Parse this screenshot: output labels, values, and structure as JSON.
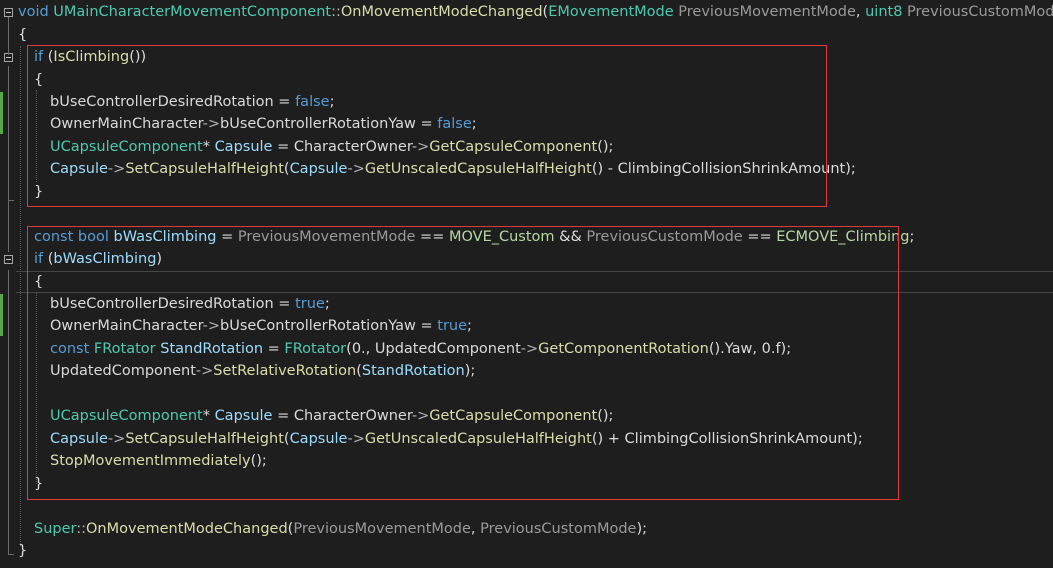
{
  "editor": {
    "lines": [
      {
        "indent": 0,
        "tokens": [
          {
            "t": "void",
            "c": "kw"
          },
          {
            "t": " ",
            "c": "t"
          },
          {
            "t": "UMainCharacterMovementComponent",
            "c": "ty"
          },
          {
            "t": "::",
            "c": "op"
          },
          {
            "t": "OnMovementModeChanged",
            "c": "fn"
          },
          {
            "t": "(",
            "c": "t"
          },
          {
            "t": "EMovementMode",
            "c": "ty"
          },
          {
            "t": " ",
            "c": "t"
          },
          {
            "t": "PreviousMovementMode",
            "c": "pm"
          },
          {
            "t": ", ",
            "c": "t"
          },
          {
            "t": "uint8",
            "c": "ty"
          },
          {
            "t": " ",
            "c": "t"
          },
          {
            "t": "PreviousCustomMode",
            "c": "pm"
          },
          {
            "t": ")",
            "c": "t"
          }
        ]
      },
      {
        "indent": 0,
        "tokens": [
          {
            "t": "{",
            "c": "t"
          }
        ]
      },
      {
        "indent": 1,
        "tokens": [
          {
            "t": "if",
            "c": "kw"
          },
          {
            "t": " (",
            "c": "t"
          },
          {
            "t": "IsClimbing",
            "c": "fn"
          },
          {
            "t": "())",
            "c": "t"
          }
        ]
      },
      {
        "indent": 1,
        "tokens": [
          {
            "t": "{",
            "c": "t"
          }
        ]
      },
      {
        "indent": 2,
        "tokens": [
          {
            "t": "bUseControllerDesiredRotation",
            "c": "mb"
          },
          {
            "t": " = ",
            "c": "t"
          },
          {
            "t": "false",
            "c": "kw"
          },
          {
            "t": ";",
            "c": "t"
          }
        ]
      },
      {
        "indent": 2,
        "tokens": [
          {
            "t": "OwnerMainCharacter",
            "c": "mb"
          },
          {
            "t": "->",
            "c": "op"
          },
          {
            "t": "bUseControllerRotationYaw",
            "c": "mb"
          },
          {
            "t": " = ",
            "c": "t"
          },
          {
            "t": "false",
            "c": "kw"
          },
          {
            "t": ";",
            "c": "t"
          }
        ]
      },
      {
        "indent": 2,
        "tokens": [
          {
            "t": "UCapsuleComponent",
            "c": "ty"
          },
          {
            "t": "* ",
            "c": "t"
          },
          {
            "t": "Capsule",
            "c": "vr"
          },
          {
            "t": " = ",
            "c": "t"
          },
          {
            "t": "CharacterOwner",
            "c": "mb"
          },
          {
            "t": "->",
            "c": "op"
          },
          {
            "t": "GetCapsuleComponent",
            "c": "fn"
          },
          {
            "t": "();",
            "c": "t"
          }
        ]
      },
      {
        "indent": 2,
        "tokens": [
          {
            "t": "Capsule",
            "c": "vr"
          },
          {
            "t": "->",
            "c": "op"
          },
          {
            "t": "SetCapsuleHalfHeight",
            "c": "fn"
          },
          {
            "t": "(",
            "c": "t"
          },
          {
            "t": "Capsule",
            "c": "vr"
          },
          {
            "t": "->",
            "c": "op"
          },
          {
            "t": "GetUnscaledCapsuleHalfHeight",
            "c": "fn"
          },
          {
            "t": "() - ",
            "c": "t"
          },
          {
            "t": "ClimbingCollisionShrinkAmount",
            "c": "mb"
          },
          {
            "t": ");",
            "c": "t"
          }
        ]
      },
      {
        "indent": 1,
        "tokens": [
          {
            "t": "}",
            "c": "t"
          }
        ]
      },
      {
        "indent": 0,
        "tokens": []
      },
      {
        "indent": 1,
        "tokens": [
          {
            "t": "const",
            "c": "kw"
          },
          {
            "t": " ",
            "c": "t"
          },
          {
            "t": "bool",
            "c": "kw"
          },
          {
            "t": " ",
            "c": "t"
          },
          {
            "t": "bWasClimbing",
            "c": "vr"
          },
          {
            "t": " = ",
            "c": "t"
          },
          {
            "t": "PreviousMovementMode",
            "c": "pm"
          },
          {
            "t": " == ",
            "c": "t"
          },
          {
            "t": "MOVE_Custom",
            "c": "en"
          },
          {
            "t": " && ",
            "c": "t"
          },
          {
            "t": "PreviousCustomMode",
            "c": "pm"
          },
          {
            "t": " == ",
            "c": "t"
          },
          {
            "t": "ECMOVE_Climbing",
            "c": "en"
          },
          {
            "t": ";",
            "c": "t"
          }
        ]
      },
      {
        "indent": 1,
        "tokens": [
          {
            "t": "if",
            "c": "kw"
          },
          {
            "t": " (",
            "c": "t"
          },
          {
            "t": "bWasClimbing",
            "c": "vr"
          },
          {
            "t": ")",
            "c": "t"
          }
        ]
      },
      {
        "indent": 1,
        "tokens": [
          {
            "t": "{",
            "c": "t"
          }
        ]
      },
      {
        "indent": 2,
        "tokens": [
          {
            "t": "bUseControllerDesiredRotation",
            "c": "mb"
          },
          {
            "t": " = ",
            "c": "t"
          },
          {
            "t": "true",
            "c": "kw"
          },
          {
            "t": ";",
            "c": "t"
          }
        ]
      },
      {
        "indent": 2,
        "tokens": [
          {
            "t": "OwnerMainCharacter",
            "c": "mb"
          },
          {
            "t": "->",
            "c": "op"
          },
          {
            "t": "bUseControllerRotationYaw",
            "c": "mb"
          },
          {
            "t": " = ",
            "c": "t"
          },
          {
            "t": "true",
            "c": "kw"
          },
          {
            "t": ";",
            "c": "t"
          }
        ]
      },
      {
        "indent": 2,
        "tokens": [
          {
            "t": "const",
            "c": "kw"
          },
          {
            "t": " ",
            "c": "t"
          },
          {
            "t": "FRotator",
            "c": "ty"
          },
          {
            "t": " ",
            "c": "t"
          },
          {
            "t": "StandRotation",
            "c": "vr"
          },
          {
            "t": " = ",
            "c": "t"
          },
          {
            "t": "FRotator",
            "c": "ty"
          },
          {
            "t": "(0., ",
            "c": "t"
          },
          {
            "t": "UpdatedComponent",
            "c": "mb"
          },
          {
            "t": "->",
            "c": "op"
          },
          {
            "t": "GetComponentRotation",
            "c": "fn"
          },
          {
            "t": "().",
            "c": "t"
          },
          {
            "t": "Yaw",
            "c": "mb"
          },
          {
            "t": ", 0.f);",
            "c": "t"
          }
        ]
      },
      {
        "indent": 2,
        "tokens": [
          {
            "t": "UpdatedComponent",
            "c": "mb"
          },
          {
            "t": "->",
            "c": "op"
          },
          {
            "t": "SetRelativeRotation",
            "c": "fn"
          },
          {
            "t": "(",
            "c": "t"
          },
          {
            "t": "StandRotation",
            "c": "vr"
          },
          {
            "t": ");",
            "c": "t"
          }
        ]
      },
      {
        "indent": 0,
        "tokens": []
      },
      {
        "indent": 2,
        "tokens": [
          {
            "t": "UCapsuleComponent",
            "c": "ty"
          },
          {
            "t": "* ",
            "c": "t"
          },
          {
            "t": "Capsule",
            "c": "vr"
          },
          {
            "t": " = ",
            "c": "t"
          },
          {
            "t": "CharacterOwner",
            "c": "mb"
          },
          {
            "t": "->",
            "c": "op"
          },
          {
            "t": "GetCapsuleComponent",
            "c": "fn"
          },
          {
            "t": "();",
            "c": "t"
          }
        ]
      },
      {
        "indent": 2,
        "tokens": [
          {
            "t": "Capsule",
            "c": "vr"
          },
          {
            "t": "->",
            "c": "op"
          },
          {
            "t": "SetCapsuleHalfHeight",
            "c": "fn"
          },
          {
            "t": "(",
            "c": "t"
          },
          {
            "t": "Capsule",
            "c": "vr"
          },
          {
            "t": "->",
            "c": "op"
          },
          {
            "t": "GetUnscaledCapsuleHalfHeight",
            "c": "fn"
          },
          {
            "t": "() + ",
            "c": "t"
          },
          {
            "t": "ClimbingCollisionShrinkAmount",
            "c": "mb"
          },
          {
            "t": ");",
            "c": "t"
          }
        ]
      },
      {
        "indent": 2,
        "tokens": [
          {
            "t": "StopMovementImmediately",
            "c": "fn"
          },
          {
            "t": "();",
            "c": "t"
          }
        ]
      },
      {
        "indent": 1,
        "tokens": [
          {
            "t": "}",
            "c": "t"
          }
        ]
      },
      {
        "indent": 0,
        "tokens": []
      },
      {
        "indent": 1,
        "tokens": [
          {
            "t": "Super",
            "c": "ty"
          },
          {
            "t": "::",
            "c": "op"
          },
          {
            "t": "OnMovementModeChanged",
            "c": "fn"
          },
          {
            "t": "(",
            "c": "t"
          },
          {
            "t": "PreviousMovementMode",
            "c": "pm"
          },
          {
            "t": ", ",
            "c": "t"
          },
          {
            "t": "PreviousCustomMode",
            "c": "pm"
          },
          {
            "t": ");",
            "c": "t"
          }
        ]
      },
      {
        "indent": 0,
        "tokens": [
          {
            "t": "}",
            "c": "t"
          }
        ]
      }
    ],
    "current_line_index": 12,
    "annotation_boxes": [
      {
        "name": "is-climbing-block",
        "from": 2,
        "to": 8
      },
      {
        "name": "was-climbing-block",
        "from": 10,
        "to": 21
      }
    ],
    "colors": {
      "background": "#1e1e1e",
      "keyword": "#569cd6",
      "type": "#4ec9b0",
      "function": "#dcdcaa",
      "parameter": "#9a9a9a",
      "enum": "#b8d7a3",
      "member": "#dadada",
      "variable": "#9cdcfe",
      "annotation_box": "#e03a3a",
      "changed_line_marker": "#57a64a"
    }
  }
}
